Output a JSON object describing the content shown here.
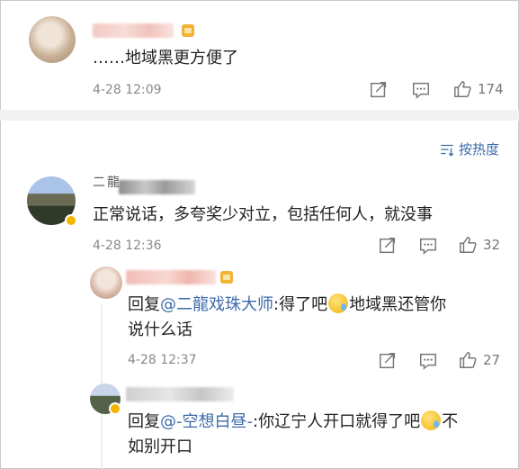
{
  "comment1": {
    "text": "……地域黑更方便了",
    "time": "4-28 12:09",
    "likes": "174",
    "icons": [
      "share-icon",
      "comment-icon",
      "like-icon"
    ]
  },
  "sort": {
    "label": "按热度"
  },
  "comment2": {
    "author": "二龍",
    "text": "正常说话，多夸奖少对立，包括任何人，就没事",
    "time": "4-28 12:36",
    "likes": "32"
  },
  "reply1": {
    "prefix": "回复",
    "mention": "@二龍戏珠大师",
    "text_a": ":得了吧",
    "text_b": "地域黑还管你",
    "line2": "说什么话",
    "time": "4-28 12:37",
    "likes": "27"
  },
  "reply2": {
    "prefix": "回复",
    "mention": "@-空想白昼-",
    "text_a": ":你辽宁人开口就得了吧",
    "text_b": "不",
    "line2": "如别开口"
  },
  "colors": {
    "mention": "#3d6ba9",
    "meta": "#888888",
    "separator": "#f2f2f2"
  }
}
